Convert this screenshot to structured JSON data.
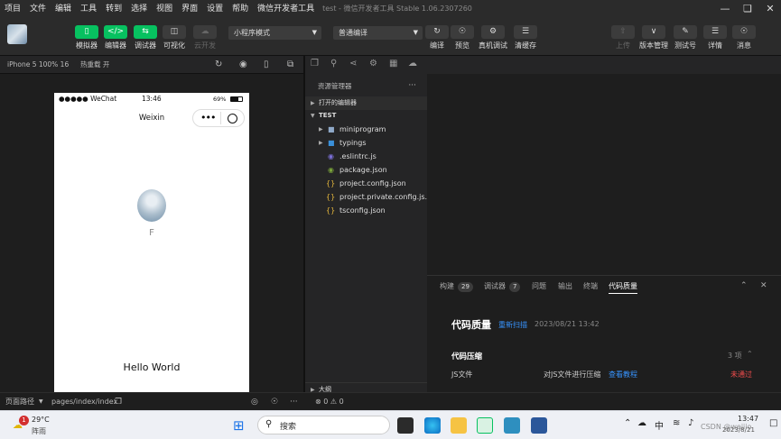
{
  "menubar": {
    "items": [
      "项目",
      "文件",
      "编辑",
      "工具",
      "转到",
      "选择",
      "视图",
      "界面",
      "设置",
      "帮助",
      "微信开发者工具"
    ],
    "title": "test - 微信开发者工具 Stable 1.06.2307260"
  },
  "toolbar": {
    "simulator": "模拟器",
    "editor": "编辑器",
    "debugger": "调试器",
    "visualize": "可视化",
    "cloud": "云开发",
    "mode": "小程序模式",
    "compile_mode": "普通编译",
    "compile": "编译",
    "preview": "预览",
    "real_debug": "真机调试",
    "clear_cache": "清缓存",
    "upload": "上传",
    "version": "版本管理",
    "test_num": "测试号",
    "details": "详情",
    "messages": "消息"
  },
  "simbar": {
    "device": "iPhone 5 100% 16",
    "hotreload": "热重载 开"
  },
  "phone": {
    "carrier": "●●●●● WeChat",
    "time": "13:46",
    "battery": "69%",
    "nav_title": "Weixin",
    "user_name": "F",
    "hello": "Hello World"
  },
  "explorer": {
    "header": "资源管理器",
    "open_editors": "打开的编辑器",
    "project": "TEST",
    "files": [
      {
        "name": "miniprogram",
        "icon": "folder-icon",
        "type": "folder"
      },
      {
        "name": "typings",
        "icon": "folder-ts-icon",
        "type": "folder"
      },
      {
        "name": ".eslintrc.js",
        "icon": "eslint-icon",
        "type": "file"
      },
      {
        "name": "package.json",
        "icon": "npm-icon",
        "type": "file"
      },
      {
        "name": "project.config.json",
        "icon": "json-icon",
        "type": "file"
      },
      {
        "name": "project.private.config.js...",
        "icon": "json-icon",
        "type": "file"
      },
      {
        "name": "tsconfig.json",
        "icon": "json-icon",
        "type": "file"
      }
    ],
    "outline": "大纲",
    "problems": "⊗ 0 ⚠ 0"
  },
  "bottom": {
    "tabs": [
      {
        "label": "构建",
        "badge": "29"
      },
      {
        "label": "调试器",
        "badge": "7"
      },
      {
        "label": "问题",
        "badge": ""
      },
      {
        "label": "输出",
        "badge": ""
      },
      {
        "label": "终端",
        "badge": ""
      },
      {
        "label": "代码质量",
        "badge": ""
      }
    ],
    "quality_title": "代码质量",
    "rescan": "重新扫描",
    "scan_time": "2023/08/21 13:42",
    "section": "代码压缩",
    "section_count": "3 项",
    "row_name": "JS文件",
    "row_desc": "对JS文件进行压缩",
    "row_link": "查看教程",
    "row_status": "未通过"
  },
  "statusbar": {
    "path_label": "页面路径",
    "path": "pages/index/index"
  },
  "taskbar": {
    "weather_temp": "29°C",
    "weather_desc": "阵雨",
    "notif_count": "1",
    "search": "搜索",
    "ime": "中",
    "time": "13:47",
    "date": "2023/8/21",
    "watermark": "CSDN @weiiio"
  },
  "colors": {
    "accent": "#07c160",
    "link": "#3794ff",
    "fail": "#f14c4c"
  }
}
